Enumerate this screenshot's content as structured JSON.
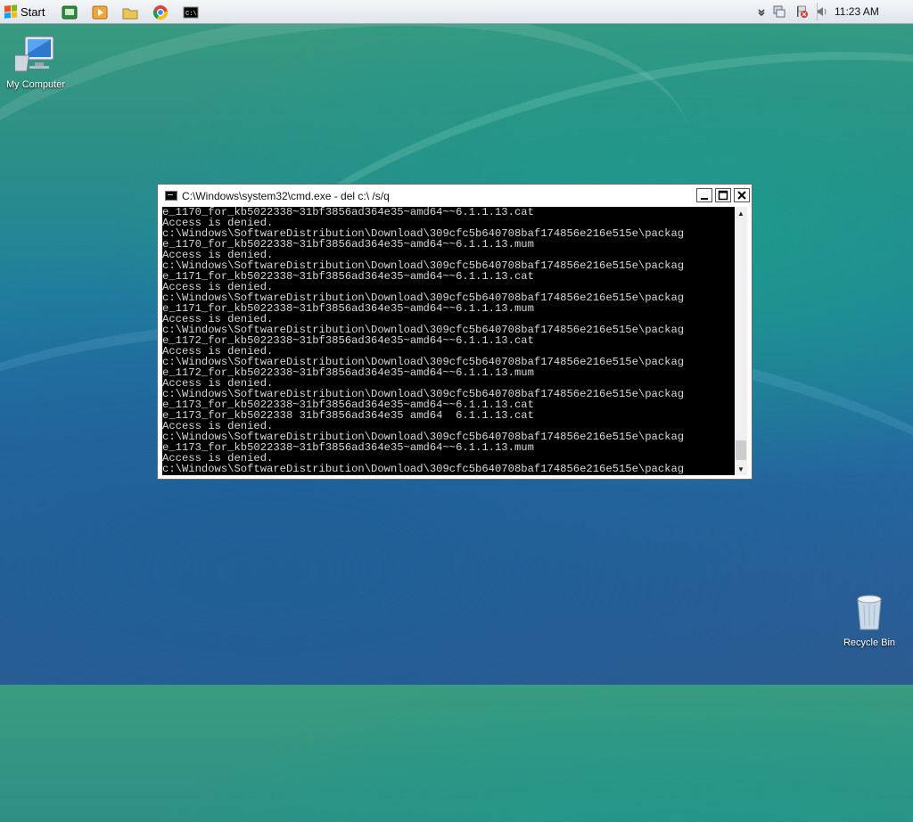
{
  "taskbar": {
    "start_label": "Start",
    "quick_launch": [
      "csharp-app-icon",
      "media-player-icon",
      "folder-icon",
      "chrome-icon",
      "cmd-icon"
    ],
    "tray_icons": [
      "chevron-down-icon",
      "network-icon",
      "flag-icon",
      "volume-icon"
    ],
    "clock": "11:23 AM",
    "colors": {
      "flag_red": "#f25022",
      "flag_green": "#7fba00",
      "flag_blue": "#00a4ef",
      "flag_yellow": "#ffb900"
    }
  },
  "desktop": {
    "my_computer_label": "My Computer",
    "recycle_bin_label": "Recycle Bin"
  },
  "cmd_window": {
    "title": "C:\\Windows\\system32\\cmd.exe - del  c:\\ /s/q",
    "lines": [
      "e_1170_for_kb5022338~31bf3856ad364e35~amd64~~6.1.1.13.cat",
      "Access is denied.",
      "c:\\Windows\\SoftwareDistribution\\Download\\309cfc5b640708baf174856e216e515e\\packag",
      "e_1170_for_kb5022338~31bf3856ad364e35~amd64~~6.1.1.13.mum",
      "Access is denied.",
      "c:\\Windows\\SoftwareDistribution\\Download\\309cfc5b640708baf174856e216e515e\\packag",
      "e_1171_for_kb5022338~31bf3856ad364e35~amd64~~6.1.1.13.cat",
      "Access is denied.",
      "c:\\Windows\\SoftwareDistribution\\Download\\309cfc5b640708baf174856e216e515e\\packag",
      "e_1171_for_kb5022338~31bf3856ad364e35~amd64~~6.1.1.13.mum",
      "Access is denied.",
      "c:\\Windows\\SoftwareDistribution\\Download\\309cfc5b640708baf174856e216e515e\\packag",
      "e_1172_for_kb5022338~31bf3856ad364e35~amd64~~6.1.1.13.cat",
      "Access is denied.",
      "c:\\Windows\\SoftwareDistribution\\Download\\309cfc5b640708baf174856e216e515e\\packag",
      "e_1172_for_kb5022338~31bf3856ad364e35~amd64~~6.1.1.13.mum",
      "Access is denied.",
      "c:\\Windows\\SoftwareDistribution\\Download\\309cfc5b640708baf174856e216e515e\\packag",
      "e_1173_for_kb5022338~31bf3856ad364e35~amd64~~6.1.1.13.cat",
      "e_1173_for_kb5022338 31bf3856ad364e35 amd64  6.1.1.13.cat",
      "Access is denied.",
      "c:\\Windows\\SoftwareDistribution\\Download\\309cfc5b640708baf174856e216e515e\\packag",
      "e_1173_for_kb5022338~31bf3856ad364e35~amd64~~6.1.1.13.mum",
      "Access is denied.",
      "c:\\Windows\\SoftwareDistribution\\Download\\309cfc5b640708baf174856e216e515e\\packag"
    ]
  }
}
